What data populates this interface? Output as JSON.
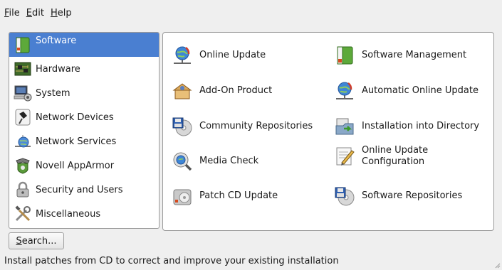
{
  "menubar": {
    "items": [
      {
        "mnemonic": "F",
        "rest": "ile"
      },
      {
        "mnemonic": "E",
        "rest": "dit"
      },
      {
        "mnemonic": "H",
        "rest": "elp"
      }
    ]
  },
  "categories": [
    {
      "label": "Software",
      "icon": "software-package-icon",
      "selected": true
    },
    {
      "label": "Hardware",
      "icon": "circuit-board-icon",
      "selected": false
    },
    {
      "label": "System",
      "icon": "computer-gear-icon",
      "selected": false
    },
    {
      "label": "Network Devices",
      "icon": "network-card-icon",
      "selected": false
    },
    {
      "label": "Network Services",
      "icon": "network-globe-icon",
      "selected": false
    },
    {
      "label": "Novell AppArmor",
      "icon": "apparmor-shield-icon",
      "selected": false
    },
    {
      "label": "Security and Users",
      "icon": "padlock-icon",
      "selected": false
    },
    {
      "label": "Miscellaneous",
      "icon": "tools-icon",
      "selected": false
    }
  ],
  "modules": {
    "left": [
      {
        "label": "Online Update",
        "icon": "online-update-globe-icon"
      },
      {
        "label": "Add-On Product",
        "icon": "add-on-product-icon"
      },
      {
        "label": "Community Repositories",
        "icon": "community-repos-disk-icon"
      },
      {
        "label": "Media Check",
        "icon": "media-check-magnifier-icon"
      },
      {
        "label": "Patch CD Update",
        "icon": "patch-cd-icon"
      }
    ],
    "right": [
      {
        "label": "Software Management",
        "icon": "software-management-icon"
      },
      {
        "label": "Automatic Online Update",
        "icon": "automatic-online-update-icon"
      },
      {
        "label": "Installation into Directory",
        "icon": "install-into-directory-icon"
      },
      {
        "label": "Online Update\nConfiguration",
        "icon": "update-configuration-pencil-icon"
      },
      {
        "label": "Software Repositories",
        "icon": "software-repositories-icon"
      }
    ]
  },
  "search_button": {
    "mnemonic": "S",
    "rest": "earch..."
  },
  "status_text": "Install patches from CD to correct and improve your existing installation",
  "colors": {
    "selection": "#4a7fd1",
    "window_background": "#efefef",
    "panel_background": "#ffffff"
  }
}
